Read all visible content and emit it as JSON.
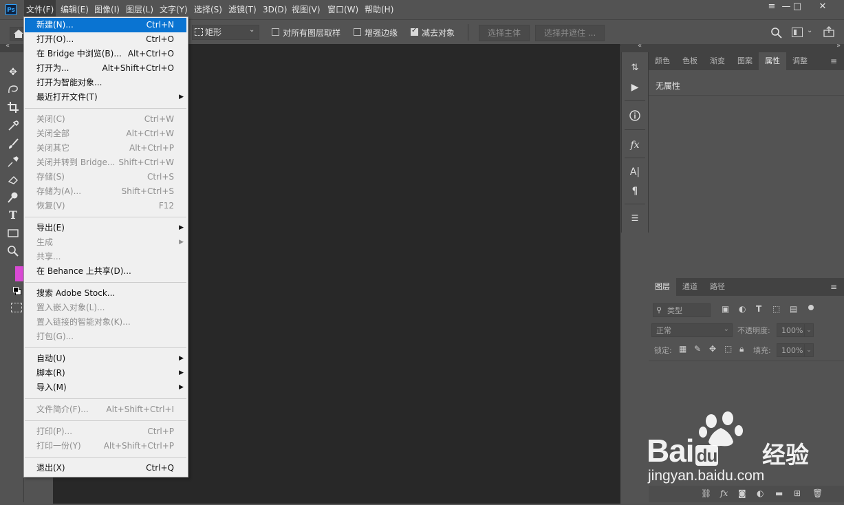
{
  "app": {
    "logo": "Ps"
  },
  "menubar": {
    "items": [
      "文件(F)",
      "编辑(E)",
      "图像(I)",
      "图层(L)",
      "文字(Y)",
      "选择(S)",
      "滤镜(T)",
      "3D(D)",
      "视图(V)",
      "窗口(W)",
      "帮助(H)"
    ]
  },
  "window_controls": {
    "menu_icon": "≡",
    "minimize": "—",
    "maximize": "□",
    "close": "✕"
  },
  "options_bar": {
    "shape_value": "矩形",
    "sample_all_layers": "对所有图层取样",
    "enhance_edge": "增强边缘",
    "subtract_target": "减去对象",
    "select_subject": "选择主体",
    "select_and_mask": "选择并遮住 ...",
    "sample_all_checked": false,
    "enhance_checked": false,
    "subtract_checked": true,
    "foreground_color": "#d94ad4"
  },
  "file_menu": {
    "items": [
      {
        "label": "新建(N)...",
        "shortcut": "Ctrl+N",
        "disabled": false,
        "highlight": true
      },
      {
        "label": "打开(O)...",
        "shortcut": "Ctrl+O",
        "disabled": false
      },
      {
        "label": "在 Bridge 中浏览(B)...",
        "shortcut": "Alt+Ctrl+O",
        "disabled": false
      },
      {
        "label": "打开为...",
        "shortcut": "Alt+Shift+Ctrl+O",
        "disabled": false
      },
      {
        "label": "打开为智能对象...",
        "shortcut": "",
        "disabled": false
      },
      {
        "label": "最近打开文件(T)",
        "shortcut": "",
        "disabled": false,
        "submenu": true
      },
      {
        "sep": true
      },
      {
        "label": "关闭(C)",
        "shortcut": "Ctrl+W",
        "disabled": true
      },
      {
        "label": "关闭全部",
        "shortcut": "Alt+Ctrl+W",
        "disabled": true
      },
      {
        "label": "关闭其它",
        "shortcut": "Alt+Ctrl+P",
        "disabled": true
      },
      {
        "label": "关闭并转到 Bridge...",
        "shortcut": "Shift+Ctrl+W",
        "disabled": true
      },
      {
        "label": "存储(S)",
        "shortcut": "Ctrl+S",
        "disabled": true
      },
      {
        "label": "存储为(A)...",
        "shortcut": "Shift+Ctrl+S",
        "disabled": true
      },
      {
        "label": "恢复(V)",
        "shortcut": "F12",
        "disabled": true
      },
      {
        "sep": true
      },
      {
        "label": "导出(E)",
        "shortcut": "",
        "disabled": false,
        "submenu": true
      },
      {
        "label": "生成",
        "shortcut": "",
        "disabled": true,
        "submenu": true
      },
      {
        "label": "共享...",
        "shortcut": "",
        "disabled": true
      },
      {
        "label": "在 Behance 上共享(D)...",
        "shortcut": "",
        "disabled": false
      },
      {
        "sep": true
      },
      {
        "label": "搜索 Adobe Stock...",
        "shortcut": "",
        "disabled": false
      },
      {
        "label": "置入嵌入对象(L)...",
        "shortcut": "",
        "disabled": true
      },
      {
        "label": "置入链接的智能对象(K)...",
        "shortcut": "",
        "disabled": true
      },
      {
        "label": "打包(G)...",
        "shortcut": "",
        "disabled": true
      },
      {
        "sep": true
      },
      {
        "label": "自动(U)",
        "shortcut": "",
        "disabled": false,
        "submenu": true
      },
      {
        "label": "脚本(R)",
        "shortcut": "",
        "disabled": false,
        "submenu": true
      },
      {
        "label": "导入(M)",
        "shortcut": "",
        "disabled": false,
        "submenu": true
      },
      {
        "sep": true
      },
      {
        "label": "文件简介(F)...",
        "shortcut": "Alt+Shift+Ctrl+I",
        "disabled": true
      },
      {
        "sep": true
      },
      {
        "label": "打印(P)...",
        "shortcut": "Ctrl+P",
        "disabled": true
      },
      {
        "label": "打印一份(Y)",
        "shortcut": "Alt+Shift+Ctrl+P",
        "disabled": true
      },
      {
        "sep": true
      },
      {
        "label": "退出(X)",
        "shortcut": "Ctrl+Q",
        "disabled": false
      }
    ]
  },
  "properties_panel": {
    "tabs": [
      "颜色",
      "色板",
      "渐变",
      "图案",
      "属性",
      "调整"
    ],
    "active_tab": "属性",
    "empty_text": "无属性"
  },
  "layers_panel": {
    "tabs": [
      "图层",
      "通道",
      "路径"
    ],
    "active_tab": "图层",
    "filter_placeholder": "类型",
    "blend_mode": "正常",
    "opacity_label": "不透明度:",
    "opacity_value": "100%",
    "lock_label": "锁定:",
    "fill_label": "填充:",
    "fill_value": "100%"
  },
  "watermark": {
    "brand": "Bai",
    "brand_suffix": "du",
    "cn": "经验",
    "url": "jingyan.baidu.com"
  }
}
